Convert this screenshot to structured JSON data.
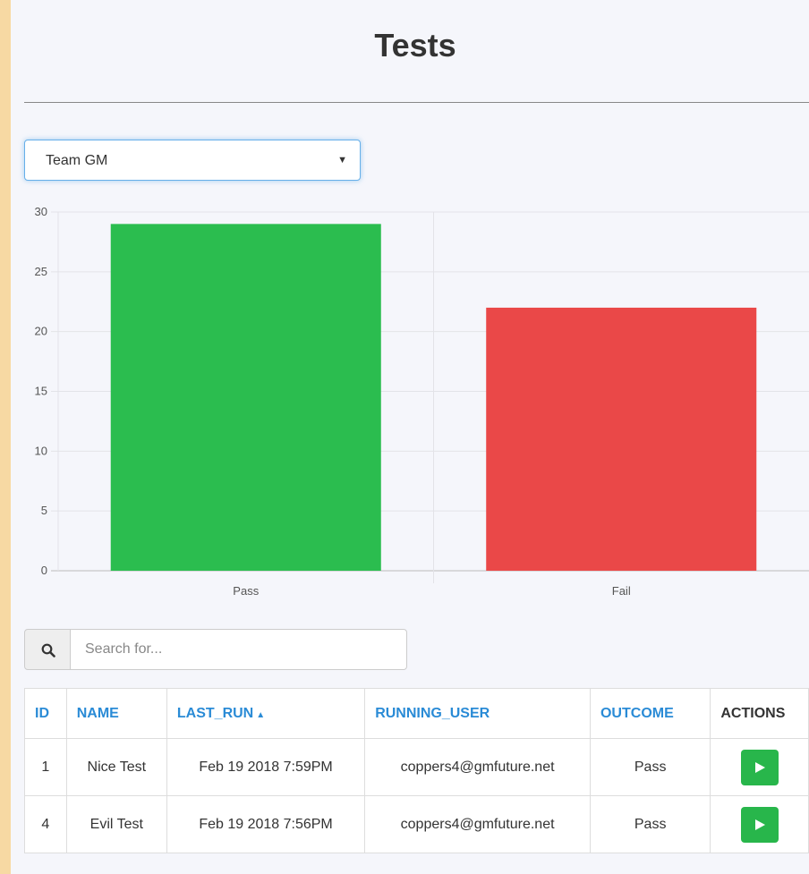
{
  "page": {
    "title": "Tests"
  },
  "team_select": {
    "value": "Team GM"
  },
  "search": {
    "placeholder": "Search for..."
  },
  "table": {
    "headers": {
      "id": "ID",
      "name": "NAME",
      "last_run": "LAST_RUN",
      "running_user": "RUNNING_USER",
      "outcome": "OUTCOME",
      "actions": "ACTIONS"
    },
    "sort": {
      "column": "last_run",
      "direction": "asc"
    },
    "rows": [
      {
        "id": "1",
        "name": "Nice Test",
        "last_run": "Feb 19 2018 7:59PM",
        "running_user": "coppers4@gmfuture.net",
        "outcome": "Pass"
      },
      {
        "id": "4",
        "name": "Evil Test",
        "last_run": "Feb 19 2018 7:56PM",
        "running_user": "coppers4@gmfuture.net",
        "outcome": "Pass"
      }
    ]
  },
  "icons": {
    "search": "search-icon",
    "run": "play-icon",
    "select": "caret-down-icon"
  },
  "colors": {
    "pass": "#2bbd4f",
    "fail": "#ea4848",
    "header_link": "#2a8bd6",
    "run_button": "#28b64b"
  },
  "chart_data": {
    "type": "bar",
    "categories": [
      "Pass",
      "Fail"
    ],
    "values": [
      29,
      22
    ],
    "colors": [
      "#2bbd4f",
      "#ea4848"
    ],
    "ylim": [
      0,
      30
    ],
    "yticks": [
      0,
      5,
      10,
      15,
      20,
      25,
      30
    ],
    "grid": true,
    "legend": "none"
  }
}
